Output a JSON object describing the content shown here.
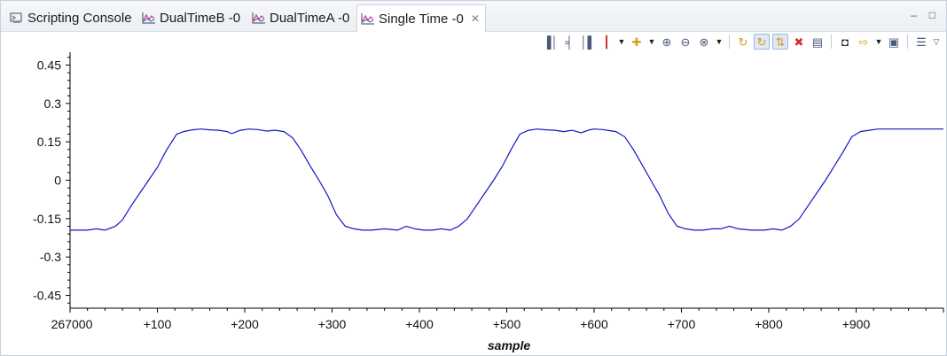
{
  "tabs": [
    {
      "label": "Scripting Console",
      "icon": "console-icon",
      "active": false
    },
    {
      "label": "DualTimeB -0",
      "icon": "graph-icon",
      "active": false
    },
    {
      "label": "DualTimeA -0",
      "icon": "graph-icon",
      "active": false
    },
    {
      "label": "Single Time -0",
      "icon": "graph-icon",
      "active": true
    }
  ],
  "toolbar_icons": [
    "align-left-icon",
    "align-center-icon",
    "align-right-icon",
    "chart-options-icon",
    "add-measurement-icon",
    "zoom-in-icon",
    "zoom-out-icon",
    "zoom-fit-icon",
    "refresh-icon",
    "continuous-refresh-icon",
    "auto-scale-icon",
    "remove-graph-icon",
    "graph-properties-icon",
    "find-icon",
    "export-icon",
    "lock-scale-icon",
    "menu-list-icon"
  ],
  "colors": {
    "trace": "#1414c8",
    "axis": "#000000"
  },
  "chart_data": {
    "type": "line",
    "xlabel": "sample",
    "ylabel": "",
    "title": "",
    "x_start": 267000,
    "xlim": [
      0,
      1000
    ],
    "ylim": [
      -0.5,
      0.5
    ],
    "x_tick_labels": [
      "267000",
      "+100",
      "+200",
      "+300",
      "+400",
      "+500",
      "+600",
      "+700",
      "+800",
      "+900"
    ],
    "y_tick_labels": [
      "0.45",
      "0.3",
      "0.15",
      "0",
      "-0.15",
      "-0.3",
      "-0.45"
    ],
    "grid": false,
    "series": [
      {
        "x": [
          0,
          20,
          30,
          40,
          52,
          60,
          70,
          80,
          90,
          100,
          110,
          122,
          130,
          140,
          150,
          160,
          170,
          180,
          185,
          195,
          205,
          215,
          225,
          235,
          245,
          255,
          265,
          275,
          285,
          295,
          305,
          315,
          325,
          335,
          345,
          360,
          375,
          385,
          395,
          405,
          415,
          425,
          435,
          445,
          455,
          465,
          475,
          485,
          495,
          505,
          515,
          525,
          535,
          545,
          555,
          565,
          575,
          585,
          595,
          600,
          610,
          615,
          625,
          635,
          645,
          655,
          665,
          675,
          685,
          695,
          705,
          715,
          725,
          735,
          745,
          755,
          765,
          780,
          795,
          805,
          815,
          825,
          835,
          845,
          855,
          865,
          875,
          885,
          895,
          905,
          915,
          925,
          935,
          945,
          955,
          965,
          975,
          985,
          995,
          1000
        ],
        "values": [
          -0.195,
          -0.195,
          -0.19,
          -0.195,
          -0.18,
          -0.155,
          -0.1,
          -0.05,
          0.0,
          0.05,
          0.115,
          0.18,
          0.19,
          0.197,
          0.2,
          0.197,
          0.195,
          0.19,
          0.182,
          0.195,
          0.2,
          0.198,
          0.192,
          0.195,
          0.19,
          0.165,
          0.115,
          0.055,
          0.0,
          -0.06,
          -0.135,
          -0.18,
          -0.19,
          -0.195,
          -0.195,
          -0.19,
          -0.195,
          -0.18,
          -0.19,
          -0.195,
          -0.195,
          -0.19,
          -0.195,
          -0.18,
          -0.15,
          -0.1,
          -0.05,
          0.0,
          0.055,
          0.12,
          0.18,
          0.195,
          0.2,
          0.197,
          0.195,
          0.19,
          0.195,
          0.185,
          0.197,
          0.2,
          0.198,
          0.195,
          0.19,
          0.17,
          0.12,
          0.06,
          0.0,
          -0.06,
          -0.13,
          -0.18,
          -0.19,
          -0.195,
          -0.195,
          -0.19,
          -0.19,
          -0.18,
          -0.19,
          -0.195,
          -0.195,
          -0.19,
          -0.195,
          -0.18,
          -0.15,
          -0.1,
          -0.05,
          0.0,
          0.055,
          0.11,
          0.17,
          0.19,
          0.195,
          0.2,
          0.2,
          0.2,
          0.2,
          0.2,
          0.2,
          0.2,
          0.2,
          0.2
        ]
      }
    ]
  }
}
